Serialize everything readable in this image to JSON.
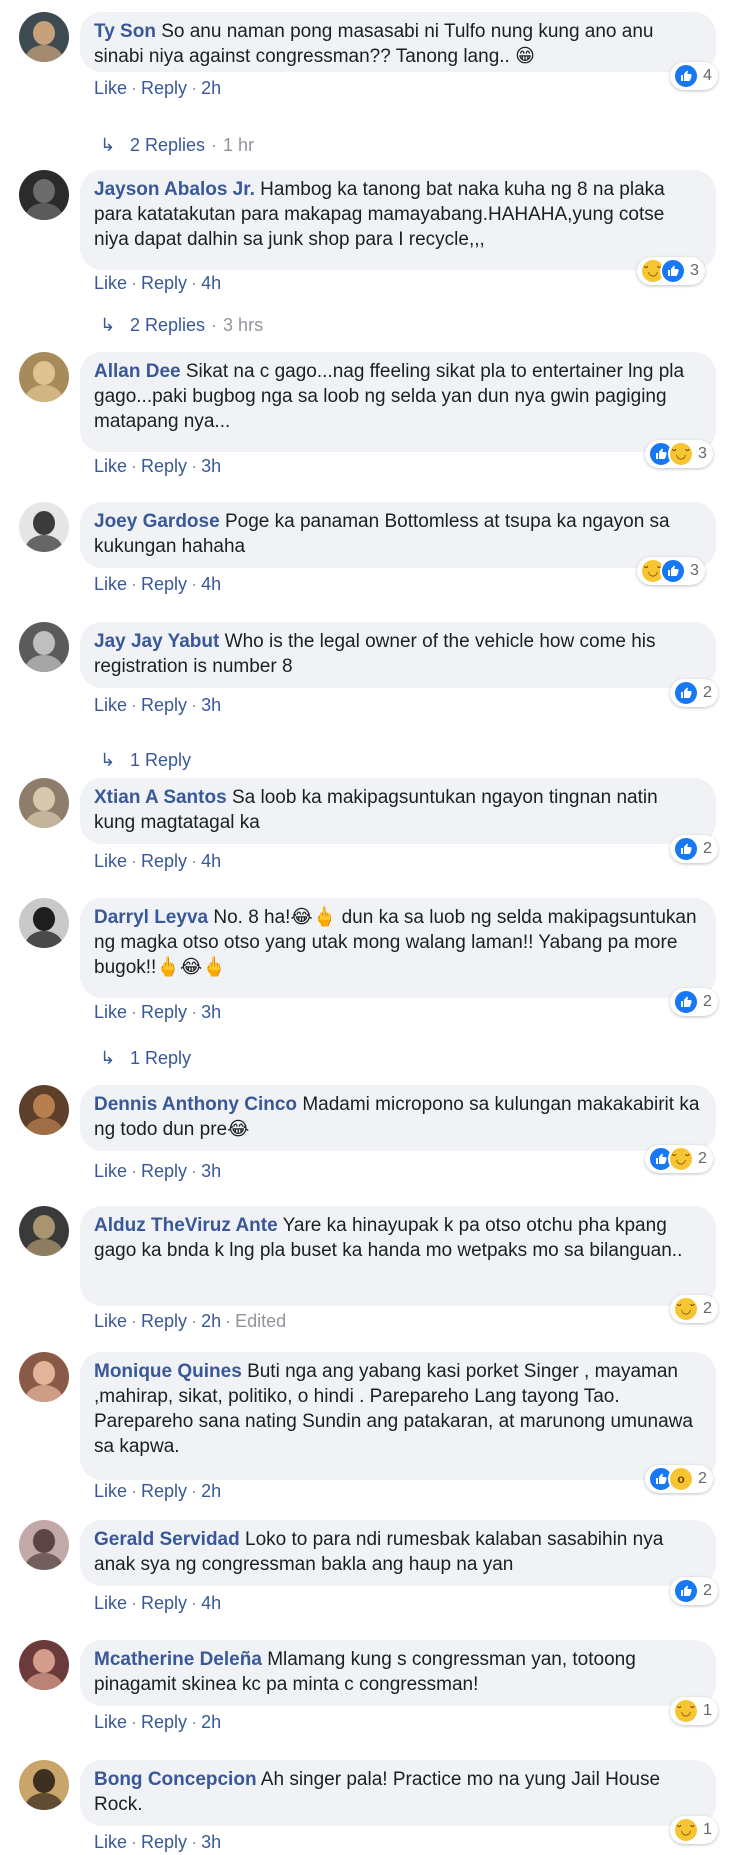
{
  "comments": [
    {
      "author": "Ty Son",
      "text": "So anu naman pong masasabi ni Tulfo nung kung ano anu sinabi niya against congressman?? Tanong lang.. 😁",
      "like": "Like",
      "reply": "Reply",
      "time": "2h",
      "edited": "",
      "reactions": [
        "like"
      ],
      "count": "4",
      "replies": {
        "label": "2 Replies",
        "time": "1 hr"
      }
    },
    {
      "author": "Jayson Abalos Jr.",
      "text": "Hambog ka tanong bat naka kuha ng 8 na plaka para katatakutan para makapag mamayabang.HAHAHA,yung cotse niya dapat dalhin sa junk shop para I recycle,,,",
      "like": "Like",
      "reply": "Reply",
      "time": "4h",
      "edited": "",
      "reactions": [
        "haha",
        "like"
      ],
      "count": "3",
      "replies": {
        "label": "2 Replies",
        "time": "3 hrs"
      }
    },
    {
      "author": "Allan Dee",
      "text": "Sikat na c gago...nag ffeeling sikat pla to entertainer lng pla gago...paki bugbog nga sa loob ng selda yan dun nya gwin pagiging matapang nya...",
      "like": "Like",
      "reply": "Reply",
      "time": "3h",
      "edited": "",
      "reactions": [
        "like",
        "haha"
      ],
      "count": "3",
      "replies": null
    },
    {
      "author": "Joey Gardose",
      "text": "Poge ka panaman Bottomless at tsupa ka ngayon sa kukungan hahaha",
      "like": "Like",
      "reply": "Reply",
      "time": "4h",
      "edited": "",
      "reactions": [
        "haha",
        "like"
      ],
      "count": "3",
      "replies": null
    },
    {
      "author": "Jay Jay Yabut",
      "text": "Who is the legal owner of the vehicle how come his registration is number 8",
      "like": "Like",
      "reply": "Reply",
      "time": "3h",
      "edited": "",
      "reactions": [
        "like"
      ],
      "count": "2",
      "replies": {
        "label": "1 Reply",
        "time": ""
      }
    },
    {
      "author": "Xtian A Santos",
      "text": "Sa loob ka makipagsuntukan ngayon tingnan natin kung magtatagal ka",
      "like": "Like",
      "reply": "Reply",
      "time": "4h",
      "edited": "",
      "reactions": [
        "like"
      ],
      "count": "2",
      "replies": null
    },
    {
      "author": "Darryl Leyva",
      "text": "No. 8 ha!😂🖕 dun ka sa luob ng selda makipagsuntukan ng magka otso otso yang utak mong walang laman!! Yabang pa more bugok!!🖕😂🖕",
      "like": "Like",
      "reply": "Reply",
      "time": "3h",
      "edited": "",
      "reactions": [
        "like"
      ],
      "count": "2",
      "replies": {
        "label": "1 Reply",
        "time": ""
      }
    },
    {
      "author": "Dennis Anthony Cinco",
      "text": "Madami micropono sa kulungan makakabirit ka ng todo dun pre😂",
      "like": "Like",
      "reply": "Reply",
      "time": "3h",
      "edited": "",
      "reactions": [
        "like",
        "haha"
      ],
      "count": "2",
      "replies": null
    },
    {
      "author": "Alduz TheViruz Ante",
      "text": "Yare ka hinayupak k pa otso otchu pha kpang gago ka bnda k lng pla buset ka handa mo wetpaks mo sa bilanguan..",
      "like": "Like",
      "reply": "Reply",
      "time": "2h",
      "edited": "Edited",
      "reactions": [
        "haha"
      ],
      "count": "2",
      "replies": null
    },
    {
      "author": "Monique Quines",
      "text": "Buti nga ang yabang kasi porket Singer , mayaman ,mahirap, sikat, politiko, o hindi . Parepareho Lang tayong Tao. Parepareho sana nating Sundin ang patakaran, at marunong umunawa sa kapwa.",
      "like": "Like",
      "reply": "Reply",
      "time": "2h",
      "edited": "",
      "reactions": [
        "like",
        "wow"
      ],
      "count": "2",
      "replies": null
    },
    {
      "author": "Gerald Servidad",
      "text": "Loko to para ndi rumesbak kalaban sasabihin nya anak sya ng congressman bakla ang haup na yan",
      "like": "Like",
      "reply": "Reply",
      "time": "4h",
      "edited": "",
      "reactions": [
        "like"
      ],
      "count": "2",
      "replies": null
    },
    {
      "author": "Mcatherine Deleña",
      "text": "Mlamang kung s congressman yan, totoong pinagamit skinea kc pa minta c congressman!",
      "like": "Like",
      "reply": "Reply",
      "time": "2h",
      "edited": "",
      "reactions": [
        "haha"
      ],
      "count": "1",
      "replies": null
    },
    {
      "author": "Bong Concepcion",
      "text": "Ah singer pala! Practice mo na yung Jail House Rock.",
      "like": "Like",
      "reply": "Reply",
      "time": "3h",
      "edited": "",
      "reactions": [
        "haha"
      ],
      "count": "1",
      "replies": null
    }
  ]
}
